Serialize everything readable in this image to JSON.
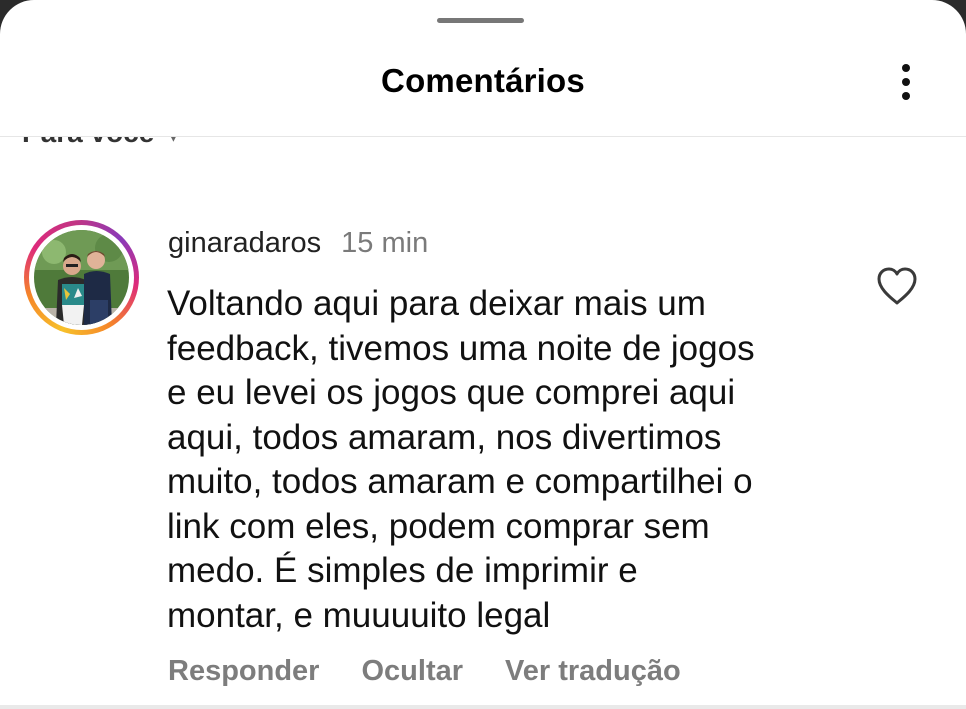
{
  "header": {
    "title": "Comentários",
    "more_icon": "more-vertical-icon"
  },
  "sort": {
    "label": "Para você",
    "icon": "chevron-down-icon"
  },
  "comment": {
    "username": "ginaradaros",
    "time": "15 min",
    "text": "Voltando aqui para deixar mais um\nfeedback,  tivemos uma noite de jogos\ne eu levei os jogos que comprei aqui\naqui, todos amaram, nos divertimos\nmuito, todos amaram e compartilhei o\nlink com eles, podem comprar sem\nmedo. É simples  de imprimir e\nmontar, e muuuuito legal",
    "like_icon": "heart-outline-icon",
    "actions": {
      "reply": "Responder",
      "hide": "Ocultar",
      "translate": "Ver tradução"
    }
  },
  "colors": {
    "background": "#ffffff",
    "text": "#111111",
    "secondary_text": "#7d7d7d"
  }
}
